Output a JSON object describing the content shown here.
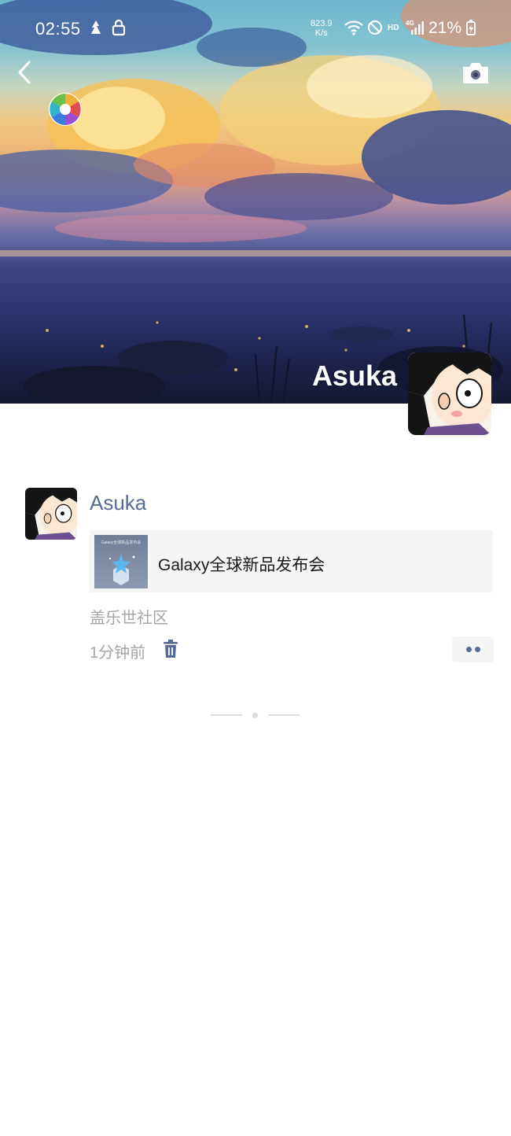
{
  "status_bar": {
    "time": "02:55",
    "net_speed_value": "823.9",
    "net_speed_unit": "K/s",
    "network_tags": [
      "HD",
      "4G"
    ],
    "battery_percent": "21%"
  },
  "header": {
    "back_icon": "chevron-left-icon",
    "camera_icon": "camera-icon",
    "logo_icon": "aperture-icon"
  },
  "profile": {
    "name": "Asuka"
  },
  "post": {
    "author": "Asuka",
    "link_title": "Galaxy全球新品发布会",
    "link_thumb_caption": "Galaxy全球新品发布会",
    "source": "盖乐世社区",
    "time": "1分钟前",
    "delete_icon": "trash-icon",
    "more_icon": "more-dots-icon"
  },
  "colors": {
    "author_link": "#576b95",
    "secondary_text": "#a5a5a5",
    "card_bg": "#f5f5f5"
  }
}
